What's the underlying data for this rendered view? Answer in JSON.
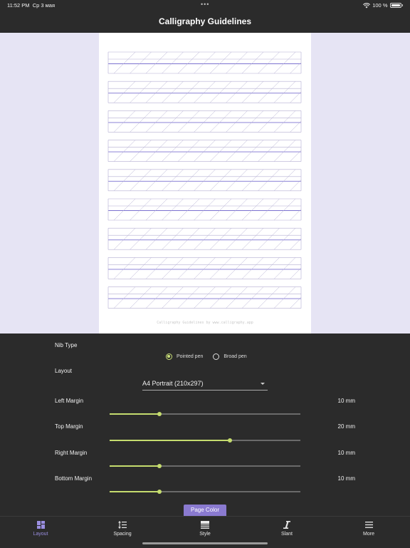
{
  "status": {
    "time": "11:52 PM",
    "date": "Ср 3 мая",
    "battery": "100 %",
    "menu_dots": "•••"
  },
  "title": "Calligraphy Guidelines",
  "preview": {
    "footer": "Calligraphy Guidelines by www.calligraphy.app",
    "rows": 9,
    "colors": {
      "background": "#e6e4f4",
      "paper": "#ffffff",
      "guide_line": "#b3aed2",
      "midline": "#7c72d0"
    }
  },
  "settings": {
    "nib_type": {
      "label": "Nib Type",
      "options": [
        "Pointed pen",
        "Broad pen"
      ],
      "selected": "Pointed pen"
    },
    "layout": {
      "label": "Layout",
      "value": "A4 Portrait  (210x297)"
    },
    "margins": [
      {
        "label": "Left Margin",
        "value": "10 mm",
        "fraction": 0.26
      },
      {
        "label": "Top Margin",
        "value": "20 mm",
        "fraction": 0.63
      },
      {
        "label": "Right Margin",
        "value": "10 mm",
        "fraction": 0.26
      },
      {
        "label": "Bottom Margin",
        "value": "10 mm",
        "fraction": 0.26
      }
    ],
    "page_color_button": "Page Color"
  },
  "tabs": [
    {
      "label": "Layout",
      "icon": "layout-icon",
      "active": true
    },
    {
      "label": "Spacing",
      "icon": "spacing-icon",
      "active": false
    },
    {
      "label": "Style",
      "icon": "style-icon",
      "active": false
    },
    {
      "label": "Slant",
      "icon": "slant-icon",
      "active": false
    },
    {
      "label": "More",
      "icon": "menu-icon",
      "active": false
    }
  ],
  "accent": "#c5dc6e",
  "tab_active_color": "#9a8ee0"
}
